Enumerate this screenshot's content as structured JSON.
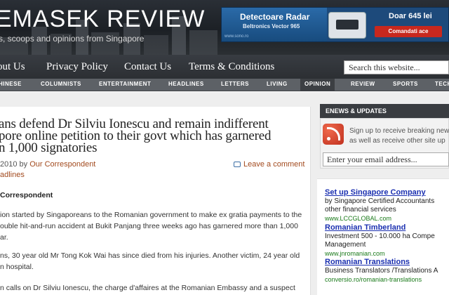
{
  "header": {
    "site_title": "EMASEK REVIEW",
    "tagline": "s, scoops and opinions from Singapore"
  },
  "ad_banner": {
    "title": "Detectoare Radar",
    "subtitle": "Beltronics Vector 965",
    "price": "Doar 645 lei",
    "cta": "Comandati ace",
    "url": "www.sono.ro"
  },
  "main_nav": {
    "items": [
      "out Us",
      "Privacy Policy",
      "Contact Us",
      "Terms & Conditions"
    ],
    "search_value": "Search this website..."
  },
  "category_nav": {
    "items": [
      "HINESE",
      "COLUMNISTS",
      "ENTERTAINMENT",
      "HEADLINES",
      "LETTERS",
      "LIVING",
      "OPINION",
      "REVIEW",
      "SPORTS",
      "TECH"
    ]
  },
  "article": {
    "title_lines": [
      "ans defend Dr Silviu Ionescu and remain indifferent",
      "pore online petition to their govt which has garnered",
      "n 1,000 signatories"
    ],
    "meta_date": "2010 by ",
    "meta_author": "Our Correspondent",
    "category": "adlines",
    "comment_link": "Leave a comment",
    "byline": "Correspondent",
    "para1": [
      "ion started by Singaporeans to the Romanian government to make ex gratia payments to the",
      "ouble hit-and-run accident at Bukit Panjang three weeks ago has garnered more than 1,000",
      "ar."
    ],
    "para2": [
      "ns, 30 year old Mr Tong Kok Wai has since died from his injuries. Another victim, 24 year old",
      "n hospital."
    ],
    "para3": [
      "n calls on Dr Silviu Ionescu, the charge d'affaires at the Romanian Embassy and a suspect"
    ]
  },
  "sidebar": {
    "heading": "ENEWS & UPDATES",
    "text_lines": [
      "Sign up to receive breaking new",
      "as well as receive other site up"
    ],
    "email_value": "Enter your email address...",
    "ads": [
      {
        "title": "Set up Singapore Company",
        "desc": [
          "by Singapore Certified Accountants",
          "other financial services"
        ],
        "url": "www.LCCGLOBAL.com"
      },
      {
        "title": "Romanian Timberland",
        "desc": [
          "Investment 500 - 10.000 ha Compe",
          "Management"
        ],
        "url": "www.jnromanian.com"
      },
      {
        "title": "Romanian Translations",
        "desc": [
          "Business Translators /Translations A"
        ],
        "url": "conversio.ro/romanian-translations"
      }
    ]
  }
}
